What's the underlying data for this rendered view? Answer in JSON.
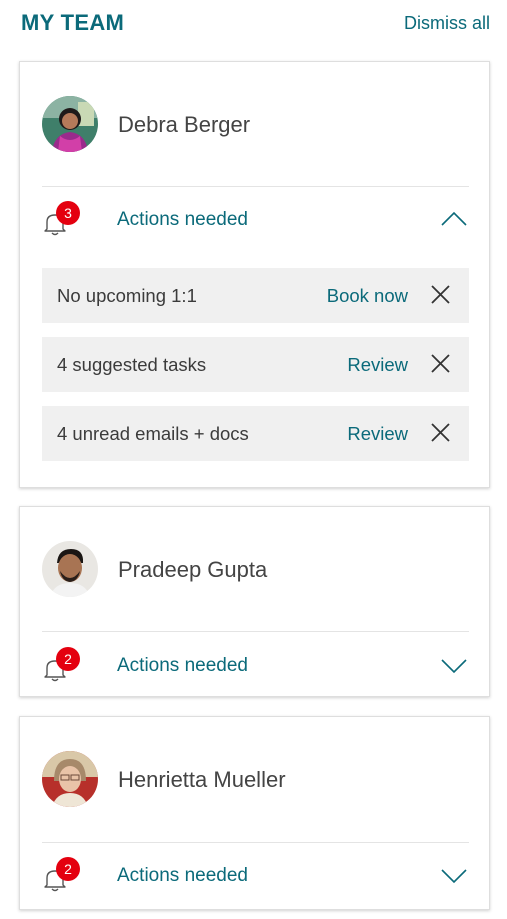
{
  "header": {
    "title": "MY TEAM",
    "dismiss_label": "Dismiss all"
  },
  "colors": {
    "accent": "#0b6a7a",
    "badge": "#e4000f",
    "item_bg": "#f0f0f0"
  },
  "members": [
    {
      "name": "Debra Berger",
      "actions_label": "Actions needed",
      "badge_count": "3",
      "expanded": true,
      "items": [
        {
          "text": "No upcoming 1:1",
          "link": "Book now"
        },
        {
          "text": "4 suggested tasks",
          "link": "Review"
        },
        {
          "text": "4 unread emails + docs",
          "link": "Review"
        }
      ]
    },
    {
      "name": "Pradeep Gupta",
      "actions_label": "Actions needed",
      "badge_count": "2",
      "expanded": false
    },
    {
      "name": "Henrietta Mueller",
      "actions_label": "Actions needed",
      "badge_count": "2",
      "expanded": false
    }
  ],
  "icons": {
    "bell": "bell-icon",
    "close": "close-icon",
    "chevron_up": "chevron-up-icon",
    "chevron_down": "chevron-down-icon"
  }
}
